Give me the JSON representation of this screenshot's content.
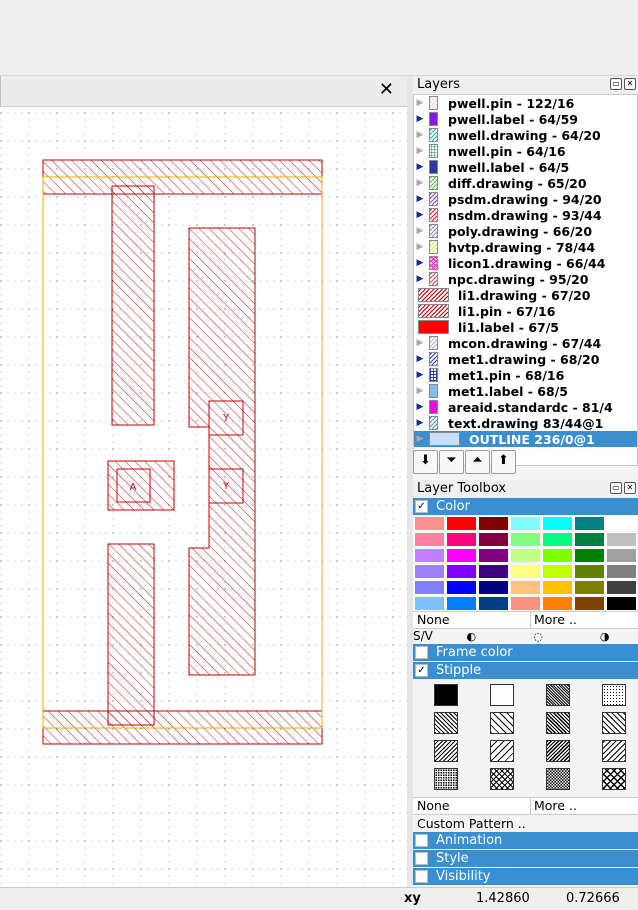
{
  "tab": {
    "close_glyph": "✕"
  },
  "layers_panel": {
    "title": "Layers",
    "layers": [
      {
        "name": "pwell.pin - 122/16",
        "color": "#f7c9e4",
        "pattern": "hatch"
      },
      {
        "name": "pwell.label - 64/59",
        "color": "#8a16e0",
        "pattern": "solid"
      },
      {
        "name": "nwell.drawing - 64/20",
        "color": "#20b0a0",
        "pattern": "hatch"
      },
      {
        "name": "nwell.pin - 64/16",
        "color": "#20a080",
        "pattern": "dots"
      },
      {
        "name": "nwell.label - 64/5",
        "color": "#2a3c9e",
        "pattern": "solid"
      },
      {
        "name": "diff.drawing - 65/20",
        "color": "#40d040",
        "pattern": "hatch"
      },
      {
        "name": "psdm.drawing - 94/20",
        "color": "#9040d0",
        "pattern": "hatch"
      },
      {
        "name": "nsdm.drawing - 93/44",
        "color": "#e02020",
        "pattern": "hatch"
      },
      {
        "name": "poly.drawing - 66/20",
        "color": "#8080e0",
        "pattern": "hatch"
      },
      {
        "name": "hvtp.drawing - 78/44",
        "color": "#e0e060",
        "pattern": "hatch"
      },
      {
        "name": "licon1.drawing - 66/44",
        "color": "#e020c0",
        "pattern": "cross"
      },
      {
        "name": "npc.drawing - 95/20",
        "color": "#e05050",
        "pattern": "hatch"
      },
      {
        "name": "li1.drawing - 67/20",
        "color": "#c00000",
        "pattern": "hatch"
      },
      {
        "name": "li1.pin - 67/16",
        "color": "#c00000",
        "pattern": "hatch"
      },
      {
        "name": "li1.label - 67/5",
        "color": "#ff0000",
        "pattern": "solid"
      },
      {
        "name": "mcon.drawing - 67/44",
        "color": "#b0b0e0",
        "pattern": "hatch"
      },
      {
        "name": "met1.drawing - 68/20",
        "color": "#2040c0",
        "pattern": "hatch"
      },
      {
        "name": "met1.pin - 68/16",
        "color": "#2040c0",
        "pattern": "grid"
      },
      {
        "name": "met1.label - 68/5",
        "color": "#80c0f0",
        "pattern": "solid"
      },
      {
        "name": "areaid.standardc - 81/4",
        "color": "#e010e0",
        "pattern": "solid"
      },
      {
        "name": "text.drawing 83/44@1",
        "color": "#4090e0",
        "pattern": "hatch"
      },
      {
        "name": "OUTLINE 236/0@1",
        "color": "#c8dff5",
        "pattern": "solid"
      }
    ],
    "selected_index": 21,
    "controls": [
      "⬇",
      "⏷",
      "⏶",
      "⬆"
    ]
  },
  "toolbox": {
    "title": "Layer Toolbox",
    "color_section": "Color",
    "palette": [
      [
        "#ff9090",
        "#ff0000",
        "#800000",
        "#80ffff",
        "#00ffff",
        "#008080",
        "#ffffff"
      ],
      [
        "#ff80a0",
        "#ff0080",
        "#800040",
        "#80ff80",
        "#00ff80",
        "#008040",
        "#c0c0c0"
      ],
      [
        "#c080ff",
        "#ff00ff",
        "#800080",
        "#c0ff80",
        "#80ff00",
        "#008000",
        "#a0a0a0"
      ],
      [
        "#a080ff",
        "#8000ff",
        "#400080",
        "#ffff80",
        "#c0ff00",
        "#608000",
        "#808080"
      ],
      [
        "#8080ff",
        "#0000ff",
        "#000080",
        "#ffc080",
        "#ffc000",
        "#808000",
        "#404040"
      ],
      [
        "#80c0ff",
        "#0080ff",
        "#004080",
        "#ff9080",
        "#ff8000",
        "#804000",
        "#000000"
      ]
    ],
    "none_label": "None",
    "more_label": "More ..",
    "sv_label": "S/V",
    "sv_icons": [
      "◐",
      "◌",
      "◑"
    ],
    "frame_color": "Frame color",
    "stipple": "Stipple",
    "stipples": [
      "solid",
      "empty",
      "dense-diag",
      "dots",
      "diag-back",
      "diag-back-sparse",
      "diag-back-dense",
      "diag-back-med",
      "diag-fwd",
      "diag-fwd-sparse",
      "diag-fwd-dense",
      "diag-fwd-med",
      "dots-dense",
      "cross-diag",
      "checker",
      "cross-big"
    ],
    "none2": "None",
    "more2": "More ..",
    "custom_pattern": "Custom Pattern ..",
    "animation": "Animation",
    "style": "Style",
    "visibility": "Visibility"
  },
  "canvas": {
    "labels": {
      "a": "A",
      "y1": "Y",
      "y2": "Y"
    }
  },
  "status": {
    "xy_label": "xy",
    "x": "1.42860",
    "y": "0.72666"
  }
}
